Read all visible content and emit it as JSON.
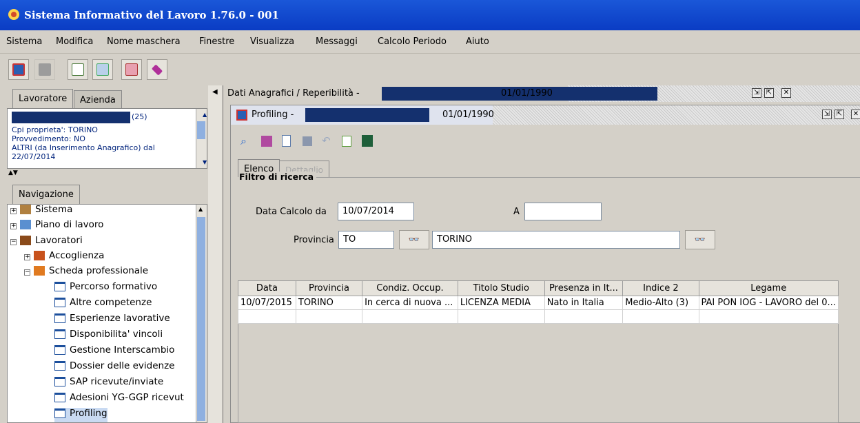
{
  "window": {
    "title": "Sistema Informativo del Lavoro 1.76.0 - 001"
  },
  "menu": [
    "Sistema",
    "Modifica",
    "Nome maschera",
    "Finestre",
    "Visualizza",
    "Messaggi",
    "Calcolo Periodo",
    "Aiuto"
  ],
  "toolbar_icons": [
    "refresh-icon",
    "users-icon",
    "binary-icon",
    "checklist-icon",
    "document-icon",
    "eraser-icon"
  ],
  "left_tabs": {
    "tab1": "Lavoratore",
    "tab2": "Azienda"
  },
  "worker": {
    "count": "(25)",
    "line1": "Cpi proprieta': TORINO",
    "line2": "Provvedimento: NO",
    "line3": "ALTRI (da Inserimento Anagrafico) dal",
    "line4": "22/07/2014"
  },
  "nav_tab": "Navigazione",
  "tree": [
    "Sistema",
    "Piano di lavoro",
    "Lavoratori",
    "Accoglienza",
    "Scheda professionale",
    "Percorso formativo",
    "Altre competenze",
    "Esperienze lavorative",
    "Disponibilita' vincoli",
    "Gestione Interscambio",
    "Dossier delle evidenze",
    "SAP ricevute/inviate",
    "Adesioni YG-GGP ricevut",
    "Profiling"
  ],
  "outer_frame": {
    "title": "Dati Anagrafici / Reperibilità -",
    "date": "01/01/1990"
  },
  "inner_frame": {
    "title": "Profiling -",
    "date": "01/01/1990"
  },
  "inner_tabs": {
    "elenco": "Elenco",
    "dettaglio": "Dettaglio"
  },
  "filter": {
    "legend": "Filtro di ricerca",
    "data_label": "Data Calcolo da",
    "data_value": "10/07/2014",
    "a_label": "A",
    "a_value": "",
    "provincia_label": "Provincia",
    "provincia_code": "TO",
    "provincia_name": "TORINO"
  },
  "table": {
    "headers": [
      "Data",
      "Provincia",
      "Condiz. Occup.",
      "Titolo Studio",
      "Presenza in It...",
      "Indice 2",
      "Legame"
    ],
    "rows": [
      [
        "10/07/2015",
        "TORINO",
        "In cerca di nuova ...",
        "LICENZA MEDIA",
        "Nato in Italia",
        "Medio-Alto (3)",
        "PAI PON IOG - LAVORO del 0..."
      ]
    ]
  },
  "colors": {
    "title_bar": "#0a3cc4",
    "redacted": "#14306e",
    "background": "#d4d0c8"
  }
}
